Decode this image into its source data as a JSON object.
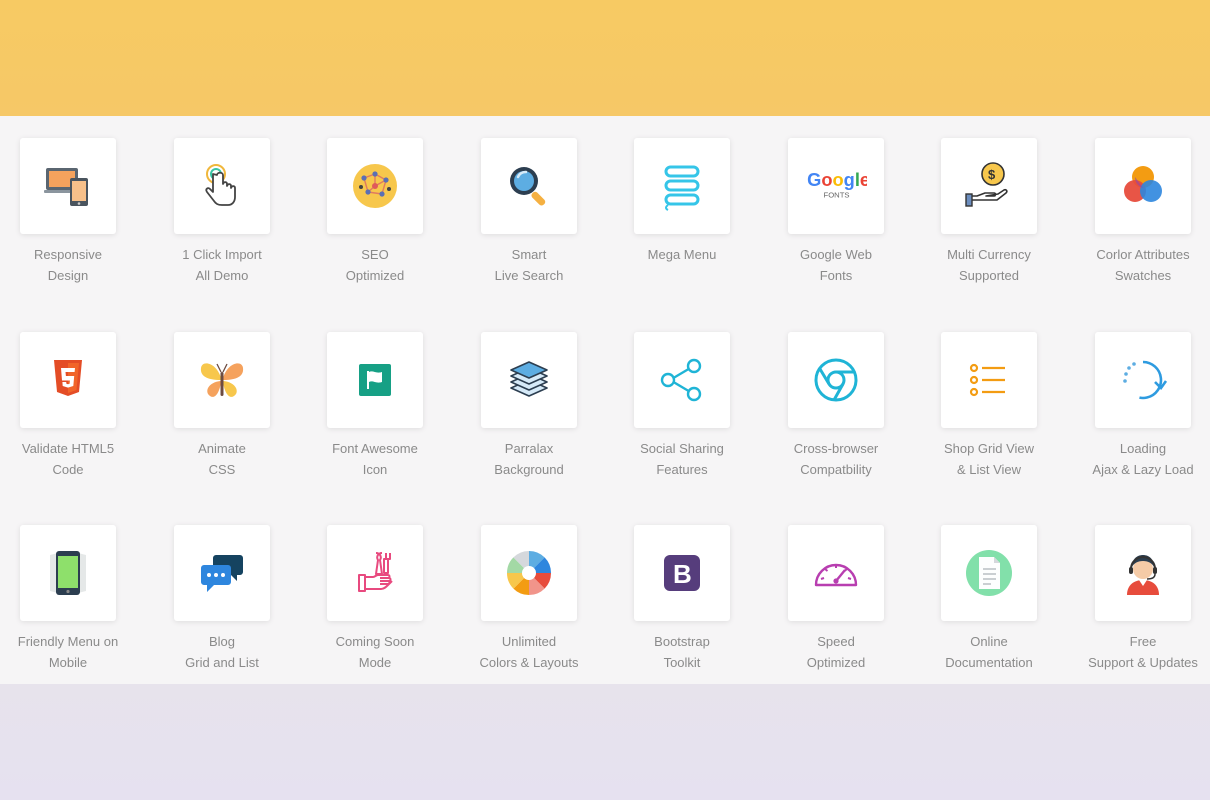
{
  "colors": {
    "top_band": "#f7ca63",
    "bottom_band": "#e7e3ec",
    "tile_bg": "#ffffff",
    "label_text": "#8a8a8a"
  },
  "features": [
    {
      "icon": "responsive-devices-icon",
      "line1": "Responsive",
      "line2": "Design"
    },
    {
      "icon": "touch-click-icon",
      "line1": "1 Click Import",
      "line2": "All Demo"
    },
    {
      "icon": "seo-network-icon",
      "line1": "SEO",
      "line2": "Optimized"
    },
    {
      "icon": "magnifier-search-icon",
      "line1": "Smart",
      "line2": "Live Search"
    },
    {
      "icon": "mega-menu-stack-icon",
      "line1": "Mega Menu",
      "line2": ""
    },
    {
      "icon": "google-fonts-icon",
      "line1": "Google Web",
      "line2": "Fonts"
    },
    {
      "icon": "currency-hand-icon",
      "line1": "Multi Currency",
      "line2": "Supported"
    },
    {
      "icon": "color-circles-icon",
      "line1": "Corlor Attributes",
      "line2": "Swatches"
    },
    {
      "icon": "html5-shield-icon",
      "line1": "Validate HTML5",
      "line2": "Code"
    },
    {
      "icon": "butterfly-icon",
      "line1": "Animate",
      "line2": "CSS"
    },
    {
      "icon": "flag-square-icon",
      "line1": "Font Awesome",
      "line2": "Icon"
    },
    {
      "icon": "layers-stack-icon",
      "line1": "Parralax",
      "line2": "Background"
    },
    {
      "icon": "share-nodes-icon",
      "line1": "Social Sharing",
      "line2": "Features"
    },
    {
      "icon": "chrome-browser-icon",
      "line1": "Cross-browser",
      "line2": "Compatbility"
    },
    {
      "icon": "list-view-icon",
      "line1": "Shop Grid View",
      "line2": "& List View"
    },
    {
      "icon": "loading-spinner-icon",
      "line1": "Loading",
      "line2": "Ajax & Lazy Load"
    },
    {
      "icon": "mobile-phone-icon",
      "line1": "Friendly Menu on",
      "line2": "Mobile"
    },
    {
      "icon": "chat-bubbles-icon",
      "line1": "Blog",
      "line2": "Grid and List"
    },
    {
      "icon": "tools-hand-icon",
      "line1": "Coming Soon",
      "line2": "Mode"
    },
    {
      "icon": "color-wheel-icon",
      "line1": "Unlimited",
      "line2": "Colors & Layouts"
    },
    {
      "icon": "bootstrap-logo-icon",
      "line1": "Bootstrap",
      "line2": "Toolkit"
    },
    {
      "icon": "speedometer-icon",
      "line1": "Speed",
      "line2": "Optimized"
    },
    {
      "icon": "document-circle-icon",
      "line1": "Online",
      "line2": "Documentation"
    },
    {
      "icon": "support-agent-icon",
      "line1": "Free",
      "line2": "Support & Updates"
    }
  ]
}
